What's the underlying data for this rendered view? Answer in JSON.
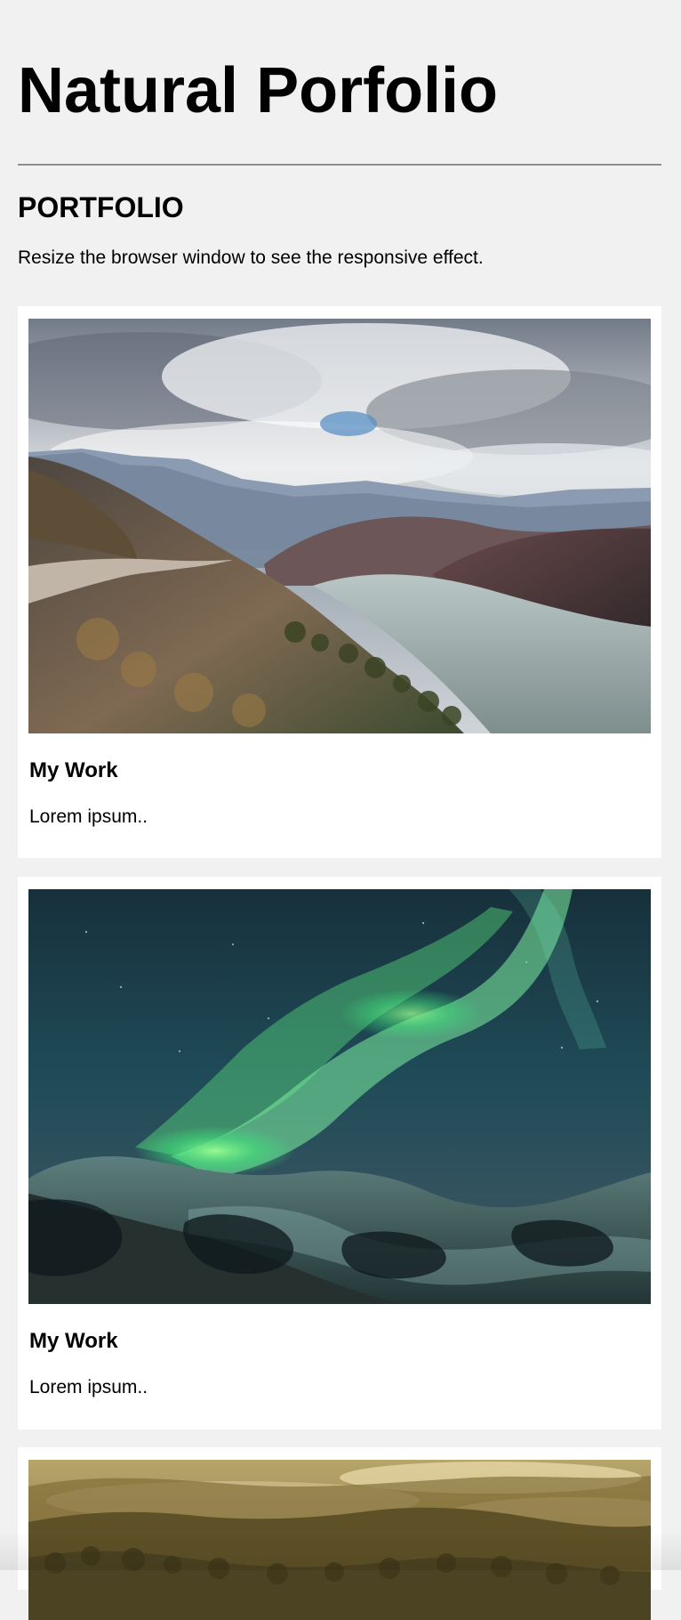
{
  "header": {
    "title": "Natural Porfolio"
  },
  "portfolio": {
    "heading": "PORTFOLIO",
    "intro": "Resize the browser window to see the responsive effect."
  },
  "cards": [
    {
      "title": "My Work",
      "text": "Lorem ipsum..",
      "image_subject": "mountain-lake-road",
      "colors": {
        "sky": "#c8cdd1",
        "cloud": "#f4f5f6",
        "mountain": "#7a889d",
        "lake": "#9fb0ae",
        "hill": "#5e4a4a"
      }
    },
    {
      "title": "My Work",
      "text": "Lorem ipsum..",
      "image_subject": "aurora-over-snowy-hills",
      "colors": {
        "sky": "#1e4b57",
        "aurora": "#57e28b",
        "snow": "#47706d",
        "rock": "#1f2a2b"
      }
    },
    {
      "title": "",
      "text": "",
      "image_subject": "misty-forest-sunrise",
      "colors": {
        "sky": "#c7b06d",
        "forest": "#7d6b34",
        "mist": "#efe2b6"
      }
    }
  ]
}
